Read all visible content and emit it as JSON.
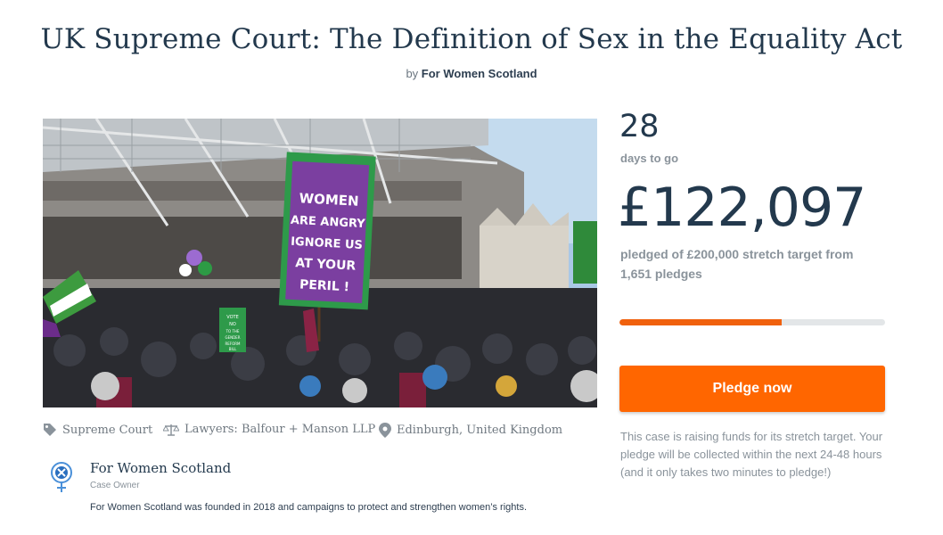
{
  "page": {
    "title": "UK Supreme Court: The Definition of Sex in the Equality Act",
    "by_prefix": "by",
    "by_name": "For Women Scotland"
  },
  "hero": {
    "sign_lines": [
      "WOMEN",
      "ARE ANGRY",
      "IGNORE US",
      "AT YOUR",
      "PERIL !"
    ],
    "small_sign": [
      "VOTE",
      "NO",
      "TO THE",
      "GENDER",
      "REFORM",
      "BILL"
    ],
    "colors": {
      "sign_purple": "#7b3fa0",
      "sign_green": "#2e9a4a",
      "sky": "#a9c8e6"
    }
  },
  "meta": {
    "category": "Supreme Court",
    "lawyers": "Lawyers: Balfour + Manson LLP",
    "location": "Edinburgh, United Kingdom"
  },
  "owner": {
    "name": "For Women Scotland",
    "role": "Case Owner",
    "description": "For Women Scotland was founded in 2018 and campaigns to protect and strengthen women’s rights."
  },
  "stats": {
    "days_number": "28",
    "days_label": "days to go",
    "amount": "£122,097",
    "pledged_text": "pledged of £200,000 stretch target from 1,651 pledges",
    "progress_fraction": 0.61
  },
  "actions": {
    "pledge_label": "Pledge now"
  },
  "note": "This case is raising funds for its stretch target. Your pledge will be collected within the next 24-48 hours (and it only takes two minutes to pledge!)",
  "colors": {
    "accent": "#ff6600",
    "heading": "#23394d",
    "muted": "#8a939b"
  }
}
